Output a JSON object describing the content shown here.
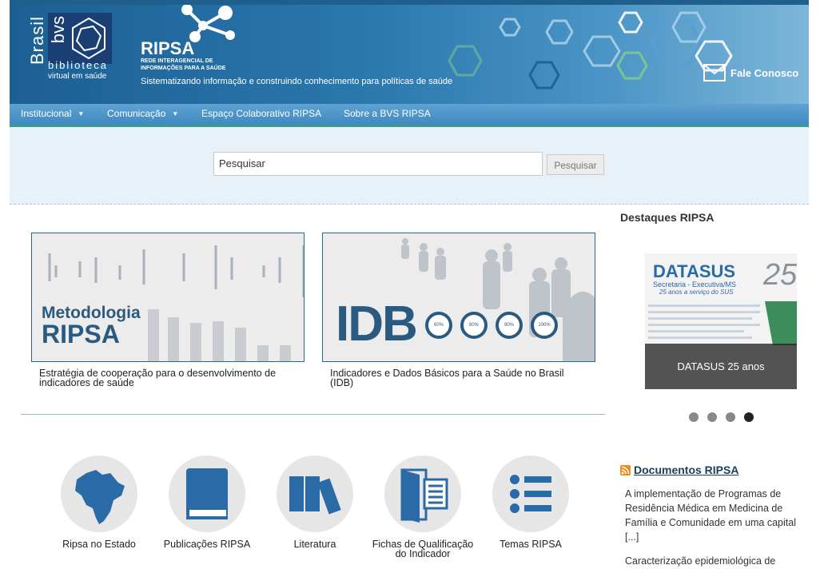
{
  "header": {
    "brasil": "Brasil",
    "bvs": "bvs",
    "biblioteca": "biblioteca",
    "virtual": "virtual em saúde",
    "ripsa_title": "RIPSA",
    "ripsa_subtitle": "REDE INTERAGENCIAL DE INFORMAÇÕES PARA A SAÚDE",
    "tagline": "Sistematizando informação e construindo conhecimento para políticas de saúde",
    "contact": "Fale Conosco"
  },
  "nav": {
    "items": [
      {
        "label": "Institucional"
      },
      {
        "label": "Comunicação"
      },
      {
        "label": "Espaço Colaborativo RIPSA"
      },
      {
        "label": "Sobre a BVS RIPSA"
      }
    ]
  },
  "search": {
    "value": "Pesquisar",
    "button": "Pesquisar"
  },
  "cards": [
    {
      "image_title_1": "Metodologia",
      "image_title_2": "RIPSA",
      "caption": "Estratégia de cooperação para o desenvolvimento de indicadores de saúde"
    },
    {
      "image_title": "IDB",
      "gauges": [
        "60%",
        "80%",
        "90%",
        "100%"
      ],
      "caption": "Indicadores e Dados Básicos para a Saúde no Brasil (IDB)"
    }
  ],
  "highlights": {
    "title": "Destaques RIPSA",
    "slide_title": "DATASUS",
    "slide_sub1": "Secretaria - Executiva/MS",
    "slide_sub2": "25 anos a serviço do SUS",
    "slide_caption": "DATASUS 25 anos",
    "active_slide": 4,
    "total_slides": 4
  },
  "documents": {
    "title": "Documentos RIPSA",
    "items": [
      "A implementação de Programas de Residência Médica em Medicina de Família e Comunidade em uma capital [...]",
      "Caracterização epidemiológica de"
    ]
  },
  "shortcuts": [
    {
      "label": "Ripsa no Estado",
      "icon": "brazil-map-icon"
    },
    {
      "label": "Publicações RIPSA",
      "icon": "book-icon"
    },
    {
      "label": "Literatura",
      "icon": "books-icon"
    },
    {
      "label": "Fichas de Qualificação do Indicador",
      "icon": "door-document-icon"
    },
    {
      "label": "Temas RIPSA",
      "icon": "list-icon"
    }
  ],
  "colors": {
    "header_dark": "#1c5f93",
    "accent_blue": "#1f6a93",
    "icon_blue": "#2a6aa6"
  }
}
